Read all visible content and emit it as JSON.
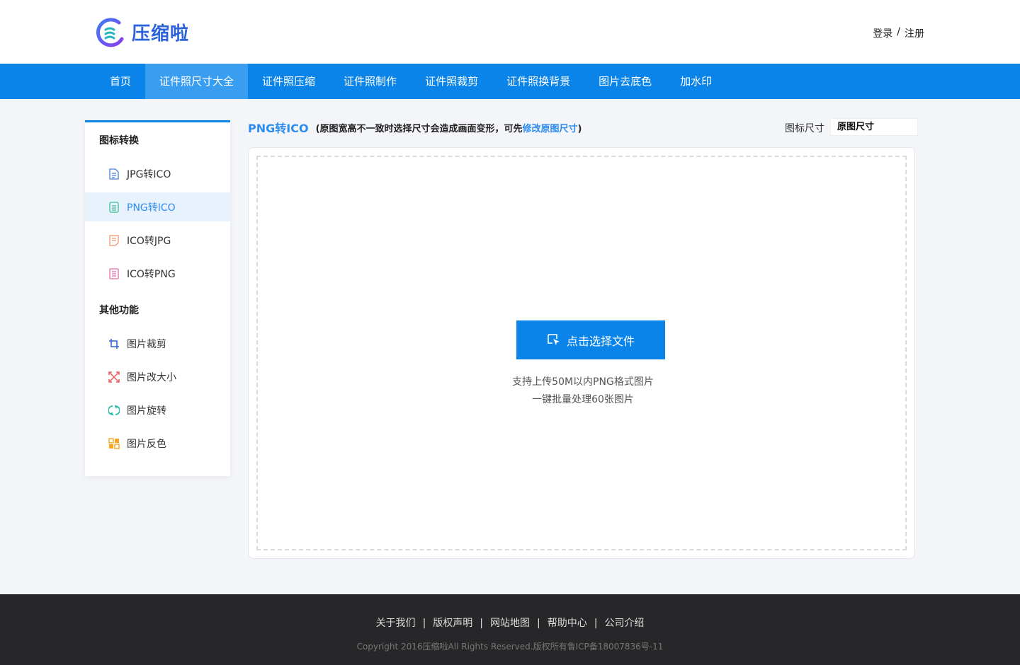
{
  "brand": {
    "name": "压缩啦"
  },
  "auth": {
    "login": "登录",
    "sep": "/",
    "register": "注册"
  },
  "nav": [
    {
      "label": "首页",
      "active": false
    },
    {
      "label": "证件照尺寸大全",
      "active": true
    },
    {
      "label": "证件照压缩",
      "active": false
    },
    {
      "label": "证件照制作",
      "active": false
    },
    {
      "label": "证件照裁剪",
      "active": false
    },
    {
      "label": "证件照换背景",
      "active": false
    },
    {
      "label": "图片去底色",
      "active": false
    },
    {
      "label": "加水印",
      "active": false
    }
  ],
  "sidebar": {
    "group1": {
      "title": "图标转换",
      "items": [
        {
          "label": "JPG转ICO",
          "icon": "file-doc-icon",
          "color": "#4a7fd6"
        },
        {
          "label": "PNG转ICO",
          "icon": "file-doc-icon",
          "color": "#3cbf8f",
          "active": true
        },
        {
          "label": "ICO转JPG",
          "icon": "file-doc-icon",
          "color": "#f0956a"
        },
        {
          "label": "ICO转PNG",
          "icon": "file-doc-icon",
          "color": "#e86aa6"
        }
      ]
    },
    "group2": {
      "title": "其他功能",
      "items": [
        {
          "label": "图片裁剪",
          "icon": "crop-icon",
          "color": "#2d63d9"
        },
        {
          "label": "图片改大小",
          "icon": "resize-icon",
          "color": "#ef5a5a"
        },
        {
          "label": "图片旋转",
          "icon": "rotate-icon",
          "color": "#27c0a6"
        },
        {
          "label": "图片反色",
          "icon": "invert-icon",
          "color": "#f5a524"
        }
      ]
    }
  },
  "main": {
    "title": "PNG转ICO",
    "note_pre": "(原图宽高不一致时选择尺寸会造成画面变形，可先",
    "note_link": "修改原图尺寸",
    "note_post": ")",
    "size_label": "图标尺寸",
    "size_value": "原图尺寸",
    "upload_button": "点击选择文件",
    "hint_line1": "支持上传50M以内PNG格式图片",
    "hint_line2": "一键批量处理60张图片"
  },
  "footer": {
    "links": [
      "关于我们",
      "版权声明",
      "网站地图",
      "帮助中心",
      "公司介绍"
    ],
    "separator": "|",
    "copyright": "Copyright 2016压缩啦All Rights Reserved.版权所有鲁ICP备18007836号-11"
  },
  "colors": {
    "primary": "#0a84e8",
    "nav_active": "#3a9ef0",
    "link": "#2d8cf0",
    "footer_bg": "#27272a"
  }
}
